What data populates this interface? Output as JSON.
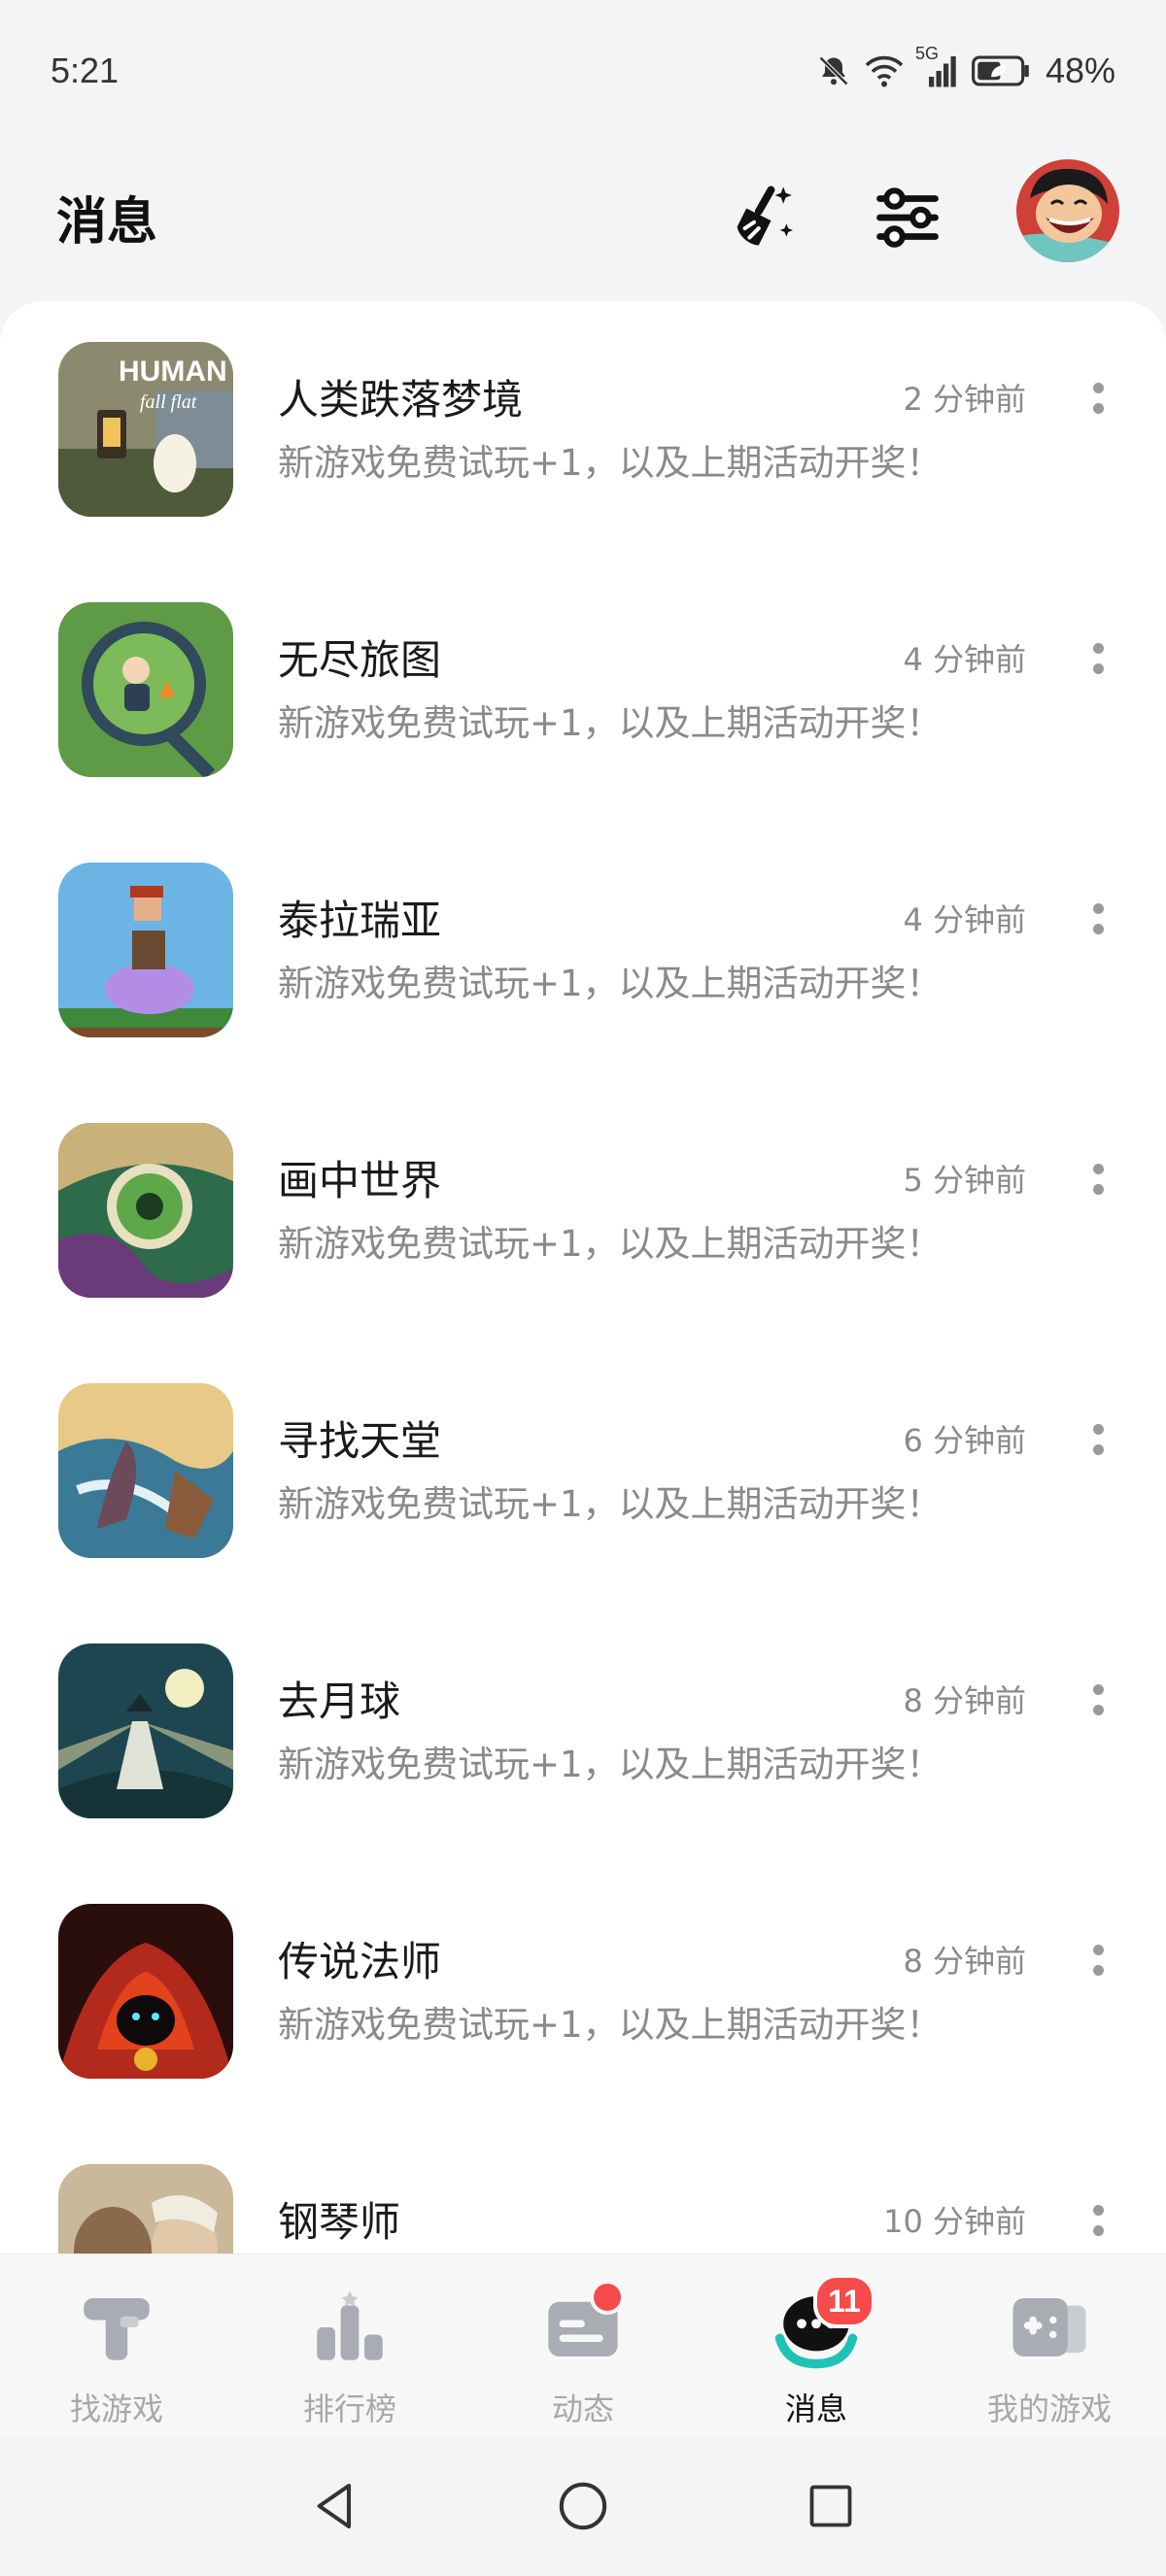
{
  "status_bar": {
    "time": "5:21",
    "network": "5G",
    "battery": "48%"
  },
  "header": {
    "title": "消息",
    "clean_icon": "broom-sparkle-icon",
    "filter_icon": "sliders-icon"
  },
  "messages": [
    {
      "name": "人类跌落梦境",
      "time": "2 分钟前",
      "preview": "新游戏免费试玩+1，以及上期活动开奖！",
      "thumb_color": "#6b6f54"
    },
    {
      "name": "无尽旅图",
      "time": "4 分钟前",
      "preview": "新游戏免费试玩+1，以及上期活动开奖！",
      "thumb_color": "#4f8a3c"
    },
    {
      "name": "泰拉瑞亚",
      "time": "4 分钟前",
      "preview": "新游戏免费试玩+1，以及上期活动开奖！",
      "thumb_color": "#5fa8de"
    },
    {
      "name": "画中世界",
      "time": "5 分钟前",
      "preview": "新游戏免费试玩+1，以及上期活动开奖！",
      "thumb_color": "#2d6b4a"
    },
    {
      "name": "寻找天堂",
      "time": "6 分钟前",
      "preview": "新游戏免费试玩+1，以及上期活动开奖！",
      "thumb_color": "#3a6f86"
    },
    {
      "name": "去月球",
      "time": "8 分钟前",
      "preview": "新游戏免费试玩+1，以及上期活动开奖！",
      "thumb_color": "#1f4a4e"
    },
    {
      "name": "传说法师",
      "time": "8 分钟前",
      "preview": "新游戏免费试玩+1，以及上期活动开奖！",
      "thumb_color": "#a8231c"
    },
    {
      "name": "钢琴师",
      "time": "10 分钟前",
      "preview": "",
      "thumb_color": "#b7a58a"
    }
  ],
  "nav": {
    "items": [
      {
        "label": "找游戏",
        "icon": "find-games-icon"
      },
      {
        "label": "排行榜",
        "icon": "leaderboard-icon"
      },
      {
        "label": "动态",
        "icon": "feed-icon"
      },
      {
        "label": "消息",
        "icon": "messages-icon"
      },
      {
        "label": "我的游戏",
        "icon": "my-games-icon"
      }
    ],
    "active": "消息",
    "messages_badge": "11"
  },
  "colors": {
    "accent": "#1fc3b3",
    "badge": "#f54b4b",
    "secondary_text": "#8a8a8a"
  }
}
